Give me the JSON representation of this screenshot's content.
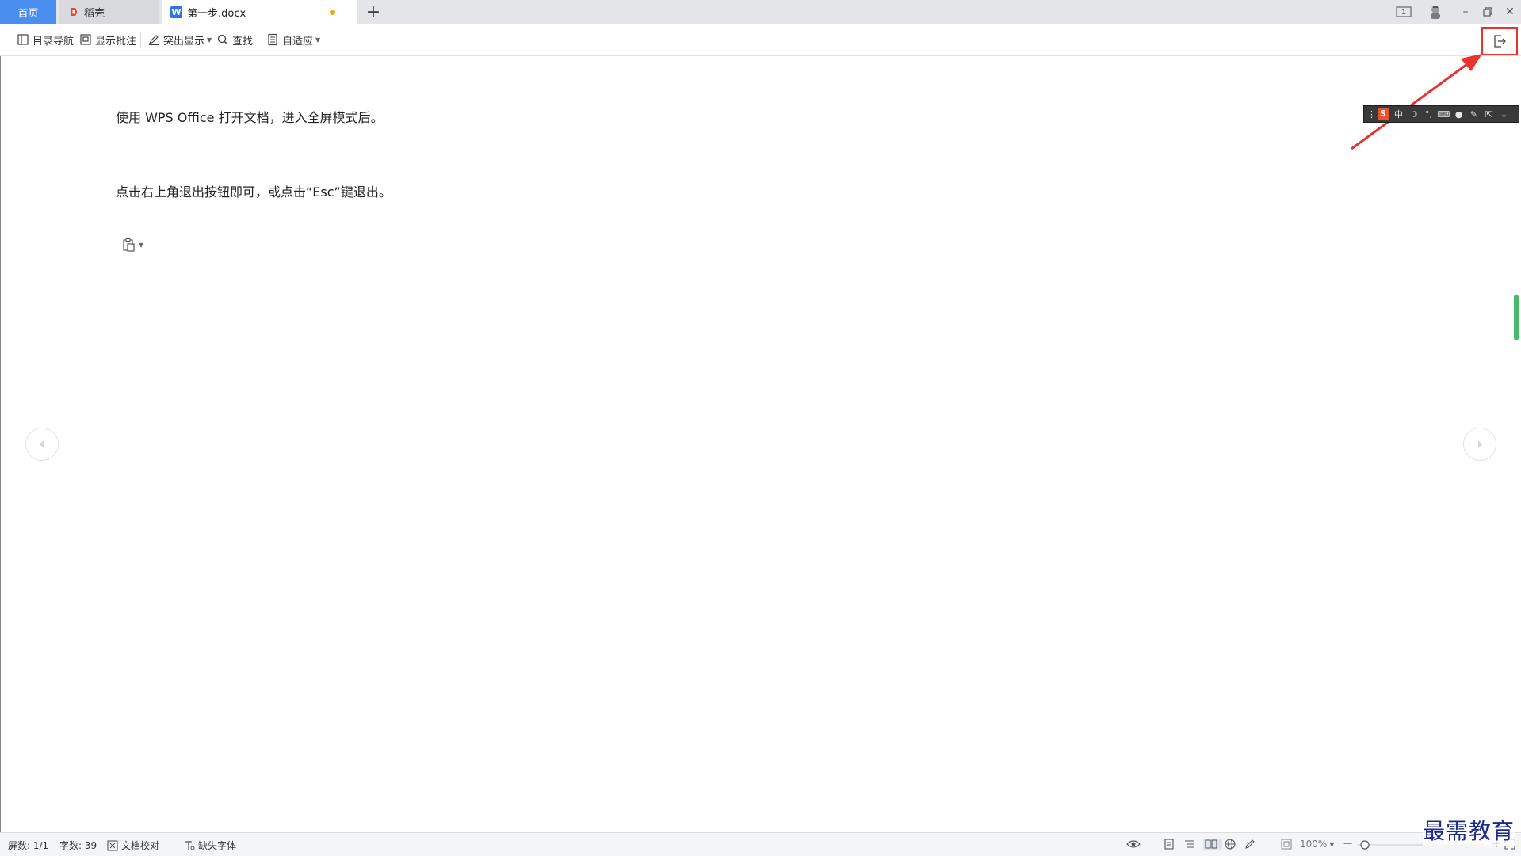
{
  "tabs": {
    "home": "首页",
    "daoke": "稻壳",
    "doc": "第一步.docx",
    "doc_icon": "W",
    "new_tab": "+"
  },
  "window_controls": {
    "page_badge": "1",
    "minimize": "–",
    "close": "✕"
  },
  "toolbar": {
    "toc_nav": "目录导航",
    "show_comments": "显示批注",
    "highlight": "突出显示",
    "find": "查找",
    "fit": "自适应"
  },
  "document": {
    "paragraphs": [
      "使用 WPS Office 打开文档，进入全屏模式后。",
      "点击右上角退出按钮即可，或点击“Esc”键退出。"
    ]
  },
  "ime_bar": {
    "logo": "S",
    "symbols": [
      "中",
      "☽",
      "°,",
      "⌨",
      "●",
      "✎",
      "⇱",
      "⌄"
    ]
  },
  "status": {
    "screens": "屏数: 1/1",
    "word_count": "字数: 39",
    "proofread": "文档校对",
    "missing_fonts": "缺失字体",
    "zoom": "100%",
    "zoom_out": "−",
    "zoom_in": "+"
  },
  "watermark": "最需教育",
  "colors": {
    "accent_blue": "#4a8ef0",
    "highlight_red": "#e8332f",
    "scroll_green": "#49b96a",
    "unsaved_dot": "#f5a623"
  }
}
